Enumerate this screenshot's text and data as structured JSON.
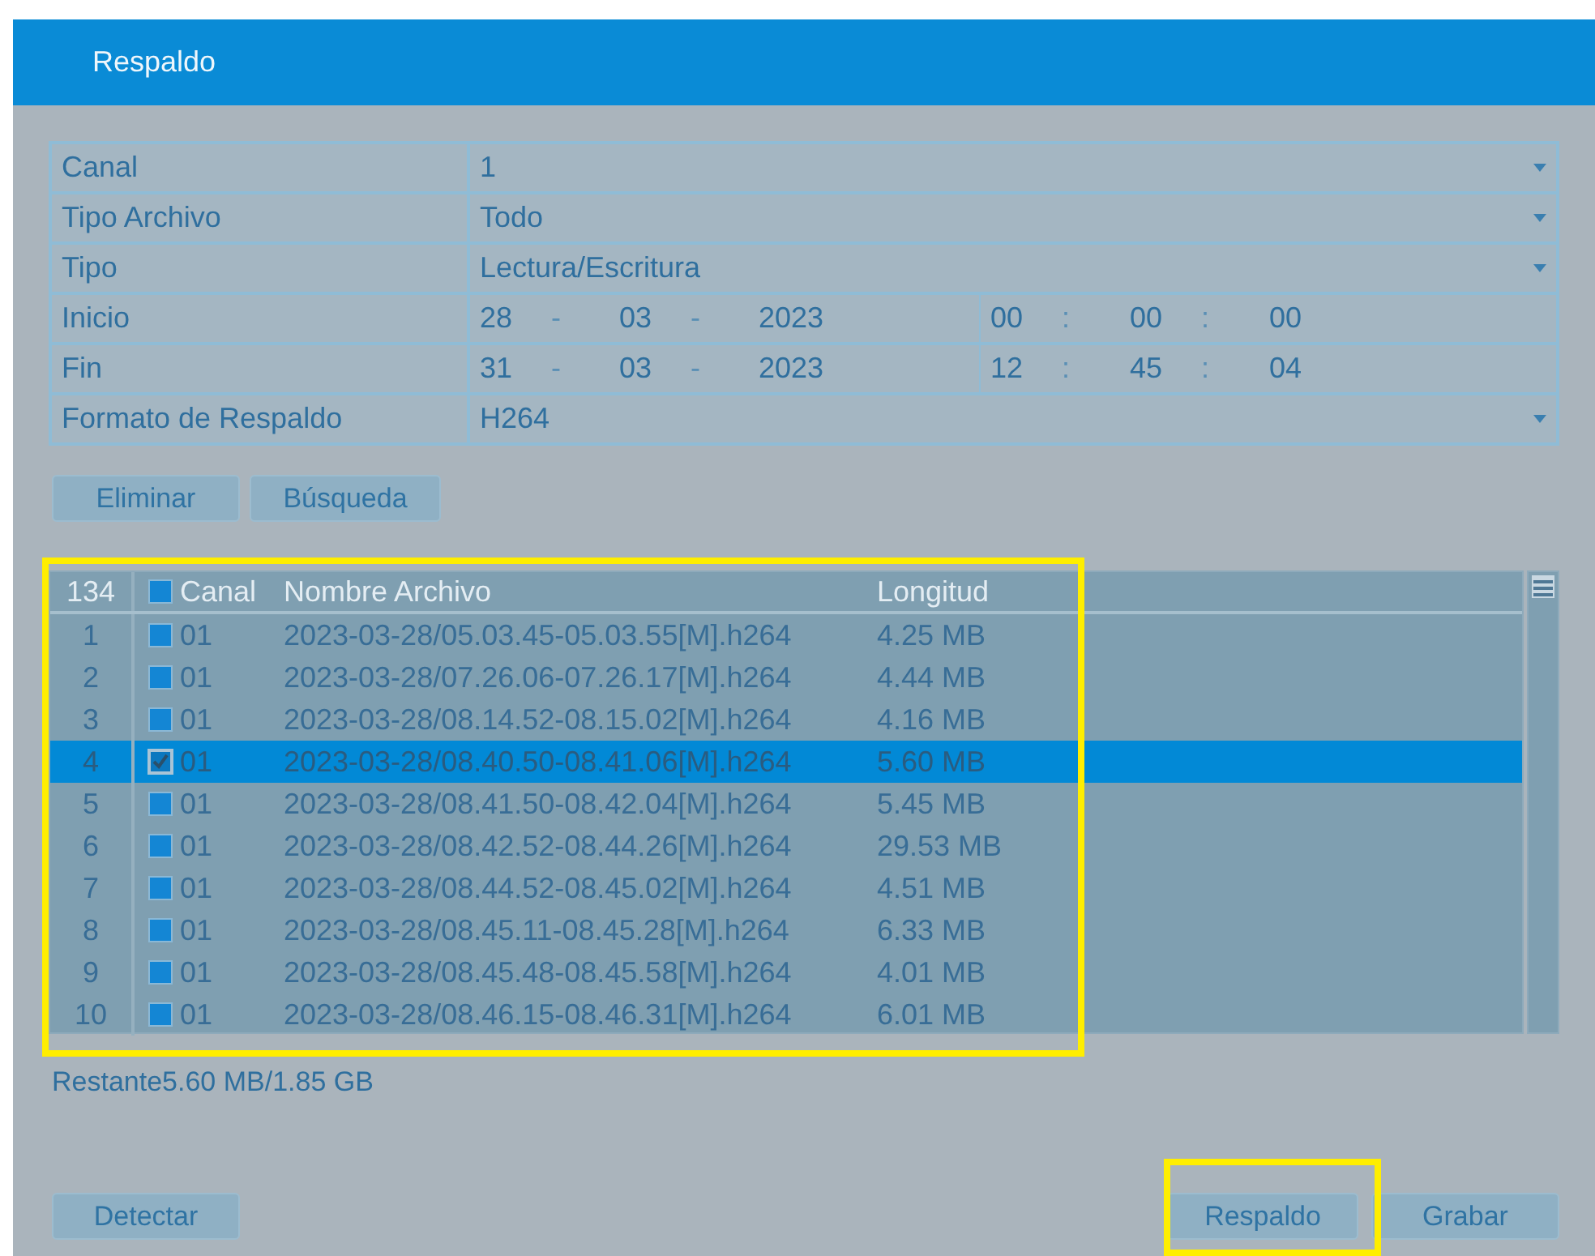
{
  "window": {
    "title": "Respaldo"
  },
  "form": [
    {
      "kind": "select",
      "label": "Canal",
      "value": "1"
    },
    {
      "kind": "select",
      "label": "Tipo Archivo",
      "value": "Todo"
    },
    {
      "kind": "select",
      "label": "Tipo",
      "value": "Lectura/Escritura"
    },
    {
      "kind": "datetime",
      "label": "Inicio",
      "date": [
        "28",
        "-",
        "03",
        "-",
        "2023"
      ],
      "time": [
        "00",
        ":",
        "00",
        ":",
        "00"
      ]
    },
    {
      "kind": "datetime",
      "label": "Fin",
      "date": [
        "31",
        "-",
        "03",
        "-",
        "2023"
      ],
      "time": [
        "12",
        ":",
        "45",
        ":",
        "04"
      ]
    },
    {
      "kind": "select",
      "label": "Formato de Respaldo",
      "value": "H264"
    }
  ],
  "search_buttons": [
    "Eliminar",
    "Búsqueda"
  ],
  "file_list": {
    "count": "134",
    "header_checked": false,
    "columns": [
      "Canal",
      "Nombre Archivo",
      "Longitud"
    ],
    "rows": [
      {
        "index": "1",
        "checked": false,
        "selected": false,
        "channel": "01",
        "name": "2023-03-28/05.03.45-05.03.55[M].h264",
        "length": "4.25 MB"
      },
      {
        "index": "2",
        "checked": false,
        "selected": false,
        "channel": "01",
        "name": "2023-03-28/07.26.06-07.26.17[M].h264",
        "length": "4.44 MB"
      },
      {
        "index": "3",
        "checked": false,
        "selected": false,
        "channel": "01",
        "name": "2023-03-28/08.14.52-08.15.02[M].h264",
        "length": "4.16 MB"
      },
      {
        "index": "4",
        "checked": true,
        "selected": true,
        "channel": "01",
        "name": "2023-03-28/08.40.50-08.41.06[M].h264",
        "length": "5.60 MB"
      },
      {
        "index": "5",
        "checked": false,
        "selected": false,
        "channel": "01",
        "name": "2023-03-28/08.41.50-08.42.04[M].h264",
        "length": "5.45 MB"
      },
      {
        "index": "6",
        "checked": false,
        "selected": false,
        "channel": "01",
        "name": "2023-03-28/08.42.52-08.44.26[M].h264",
        "length": "29.53 MB"
      },
      {
        "index": "7",
        "checked": false,
        "selected": false,
        "channel": "01",
        "name": "2023-03-28/08.44.52-08.45.02[M].h264",
        "length": "4.51 MB"
      },
      {
        "index": "8",
        "checked": false,
        "selected": false,
        "channel": "01",
        "name": "2023-03-28/08.45.11-08.45.28[M].h264",
        "length": "6.33 MB"
      },
      {
        "index": "9",
        "checked": false,
        "selected": false,
        "channel": "01",
        "name": "2023-03-28/08.45.48-08.45.58[M].h264",
        "length": "4.01 MB"
      },
      {
        "index": "10",
        "checked": false,
        "selected": false,
        "channel": "01",
        "name": "2023-03-28/08.46.15-08.46.31[M].h264",
        "length": "6.01 MB"
      }
    ]
  },
  "remaining": "Restante5.60 MB/1.85 GB",
  "buttons": [
    "Detectar",
    "Respaldo",
    "Grabar"
  ]
}
